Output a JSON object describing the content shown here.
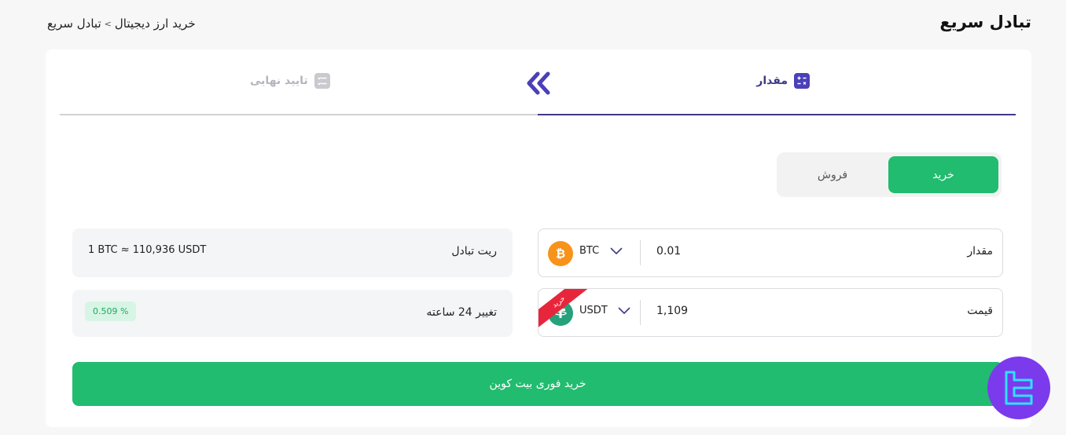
{
  "header": {
    "title": "تبادل سریع",
    "breadcrumb": {
      "parent": "خرید ارز دیجیتال",
      "separator": ">",
      "current": "تبادل سریع"
    }
  },
  "steps": {
    "amount_label": "مقدار",
    "confirm_label": "تایید نهایی"
  },
  "tabs": {
    "buy": "خرید",
    "sell": "فروش",
    "active": "buy"
  },
  "form": {
    "amount": {
      "label": "مقدار",
      "value": "0.01",
      "coin": "BTC",
      "coin_icon": "bitcoin-icon"
    },
    "price": {
      "label": "قیمت",
      "value": "1,109",
      "coin": "USDT",
      "coin_icon": "tether-icon",
      "ribbon": "خرید"
    }
  },
  "info": {
    "rate_label": "ریت تبادل",
    "rate_value": "1 BTC ≈ 110,936 USDT",
    "change_label": "تغییر 24 ساعته",
    "change_value": "0.509 %"
  },
  "cta": {
    "label": "خرید فوری بیت کوین"
  },
  "colors": {
    "primary_green": "#21bc6f",
    "step_active": "#3e3a85",
    "ribbon_red": "#e8263b",
    "logo_purple": "#7c3aed"
  }
}
